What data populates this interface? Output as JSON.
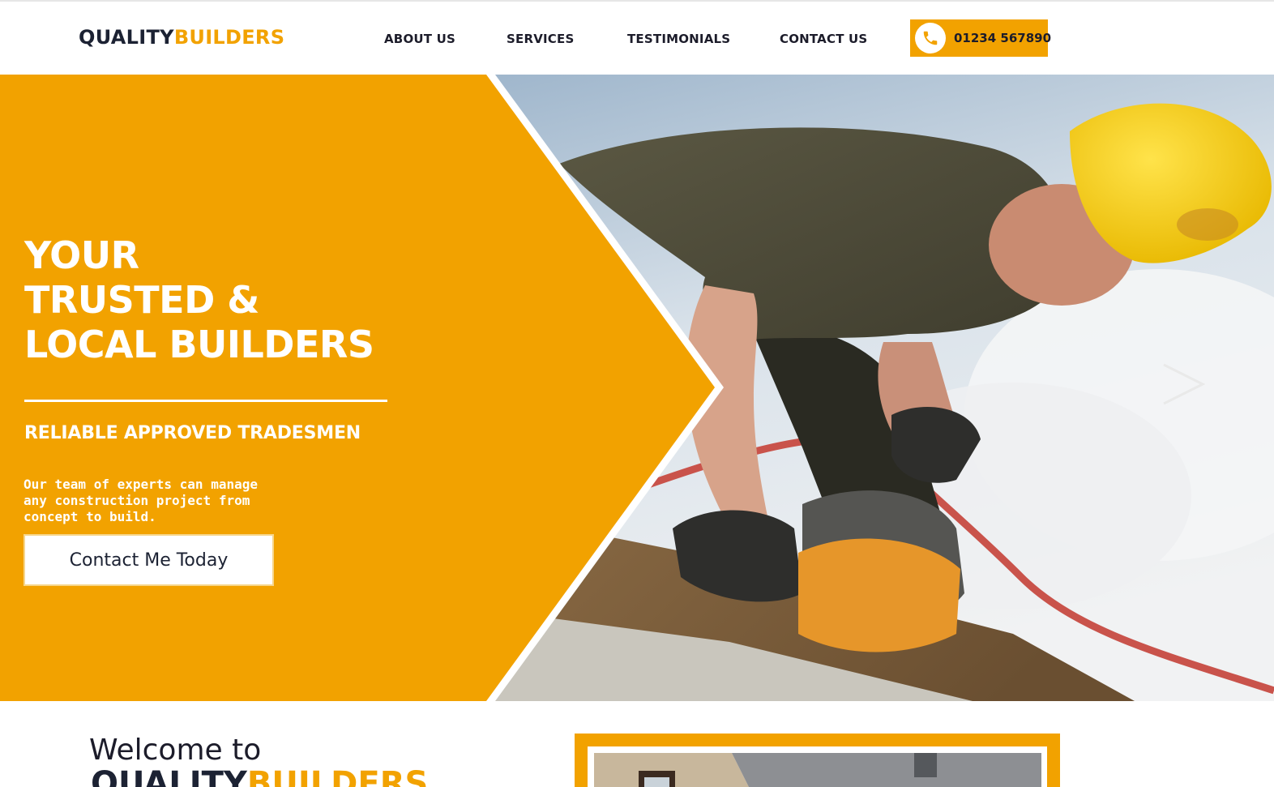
{
  "brand": {
    "part1": "QUALITY",
    "part2": "BUILDERS"
  },
  "nav": {
    "about": "ABOUT US",
    "services": "SERVICES",
    "testimonials": "TESTIMONIALS",
    "contact": "CONTACT US"
  },
  "phone": {
    "number": "01234 567890",
    "icon": "phone-icon"
  },
  "hero": {
    "title_lines": [
      "YOUR",
      "TRUSTED &",
      "LOCAL BUILDERS"
    ],
    "subtitle": "RELIABLE APPROVED TRADESMEN",
    "description_lines": [
      "Our team of experts can manage",
      "any construction project from",
      "concept to build."
    ],
    "cta_label": "Contact Me Today",
    "next_icon": "chevron-right-icon"
  },
  "welcome": {
    "heading": "Welcome to",
    "brand_part1": "QUALITY",
    "brand_part2": "BUILDERS"
  },
  "colors": {
    "accent": "#f2a200",
    "dark": "#1c2233",
    "white": "#ffffff"
  }
}
